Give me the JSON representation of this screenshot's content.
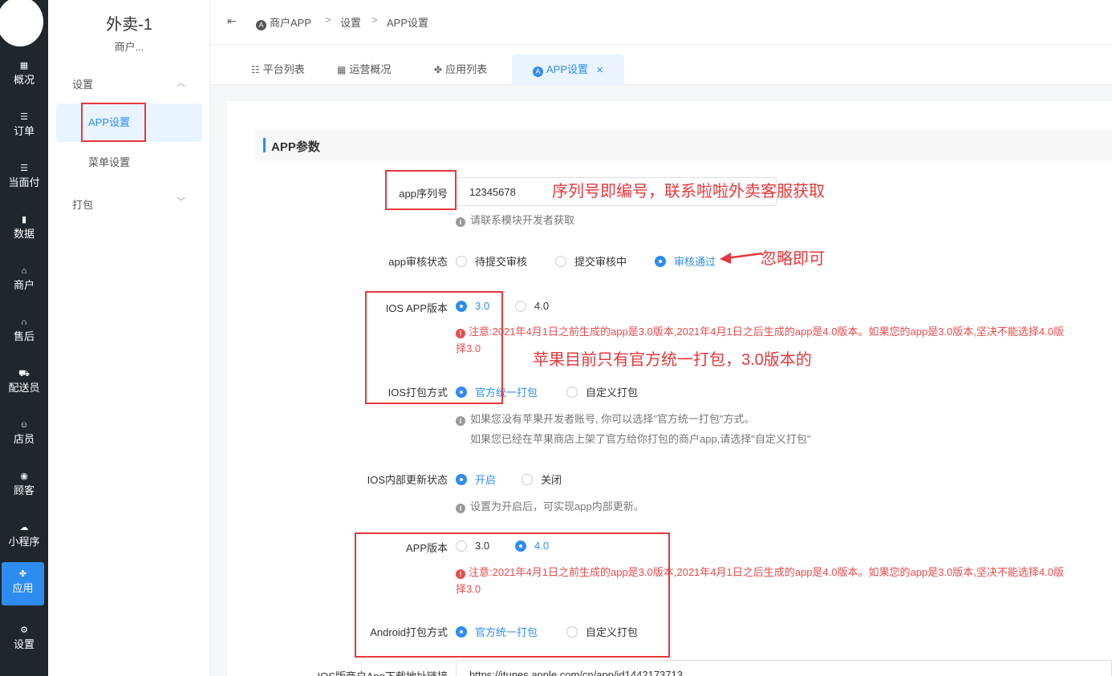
{
  "left_nav": {
    "items": [
      {
        "label": "概况",
        "icon": "dashboard-icon",
        "glyph": "▦"
      },
      {
        "label": "订单",
        "icon": "order-list-icon",
        "glyph": "☰"
      },
      {
        "label": "当面付",
        "icon": "face-pay-icon",
        "glyph": "☰"
      },
      {
        "label": "数据",
        "icon": "bar-chart-icon",
        "glyph": "▮"
      },
      {
        "label": "商户",
        "icon": "store-icon",
        "glyph": "⌂"
      },
      {
        "label": "售后",
        "icon": "headset-icon",
        "glyph": "∩"
      },
      {
        "label": "配送员",
        "icon": "delivery-icon",
        "glyph": "⛟"
      },
      {
        "label": "店员",
        "icon": "staff-icon",
        "glyph": "☺"
      },
      {
        "label": "顾客",
        "icon": "customer-icon",
        "glyph": "◉"
      },
      {
        "label": "小程序",
        "icon": "wechat-icon",
        "glyph": "☁"
      },
      {
        "label": "应用",
        "icon": "apps-icon",
        "glyph": "✤"
      },
      {
        "label": "设置",
        "icon": "settings-user-icon",
        "glyph": "⚙"
      }
    ],
    "active_label": "应用"
  },
  "sub_nav": {
    "shop_name": "外卖-1",
    "shop_sub": "商户...",
    "group_settings": "设置",
    "item_app_settings": "APP设置",
    "item_menu_settings": "菜单设置",
    "group_package": "打包"
  },
  "breadcrumb": {
    "root": "商户APP",
    "level1": "设置",
    "level2": "APP设置",
    "sep": ">"
  },
  "tabs": [
    {
      "label": "平台列表",
      "icon": "list-icon",
      "glyph": "☷"
    },
    {
      "label": "运营概况",
      "icon": "grid-icon",
      "glyph": "▦"
    },
    {
      "label": "应用列表",
      "icon": "apps-icon",
      "glyph": "✤"
    },
    {
      "label": "APP设置",
      "icon": "app-store-icon",
      "active": true
    }
  ],
  "section": {
    "title": "APP参数"
  },
  "form": {
    "serial_label": "app序列号",
    "serial_value": "12345678",
    "serial_help": "请联系模块开发者获取",
    "review_label": "app审核状态",
    "review_options": [
      "待提交审核",
      "提交审核中",
      "审核通过"
    ],
    "review_selected": "审核通过",
    "ios_version_label": "IOS APP版本",
    "ios_version_options": [
      "3.0",
      "4.0"
    ],
    "ios_version_selected": "3.0",
    "version_warning_line1": "注意:2021年4月1日之前生成的app是3.0版本,2021年4月1日之后生成的app是4.0版本。如果您的app是3.0版本,坚决不能选择4.0版",
    "version_warning_line2": "择3.0",
    "ios_pack_label": "IOS打包方式",
    "pack_options": [
      "官方统一打包",
      "自定义打包"
    ],
    "ios_pack_selected": "官方统一打包",
    "ios_pack_help1": "如果您没有苹果开发者账号, 你可以选择\"官方统一打包\"方式。",
    "ios_pack_help2": "如果您已经在苹果商店上架了官方给你打包的商户app,请选择\"自定义打包\"",
    "ios_update_label": "IOS内部更新状态",
    "ios_update_options": [
      "开启",
      "关闭"
    ],
    "ios_update_selected": "开启",
    "ios_update_help": "设置为开启后，可实现app内部更新。",
    "app_version_label": "APP版本",
    "app_version_options": [
      "3.0",
      "4.0"
    ],
    "app_version_selected": "4.0",
    "android_pack_label": "Android打包方式",
    "android_pack_selected": "官方统一打包",
    "ios_download_label": "IOS版商户App下载地址链接",
    "ios_download_value": "https://itunes.apple.com/cn/app/id1442173713"
  },
  "annotations": {
    "serial_note": "序列号即编号，联系啦啦外卖客服获取",
    "review_note": "忽略即可",
    "ios_note": "苹果目前只有官方统一打包，3.0版本的"
  },
  "colors": {
    "accent": "#2d8cf0",
    "sidebar": "#21262d",
    "annotation": "#e5383b",
    "warning": "#e94b4b"
  }
}
